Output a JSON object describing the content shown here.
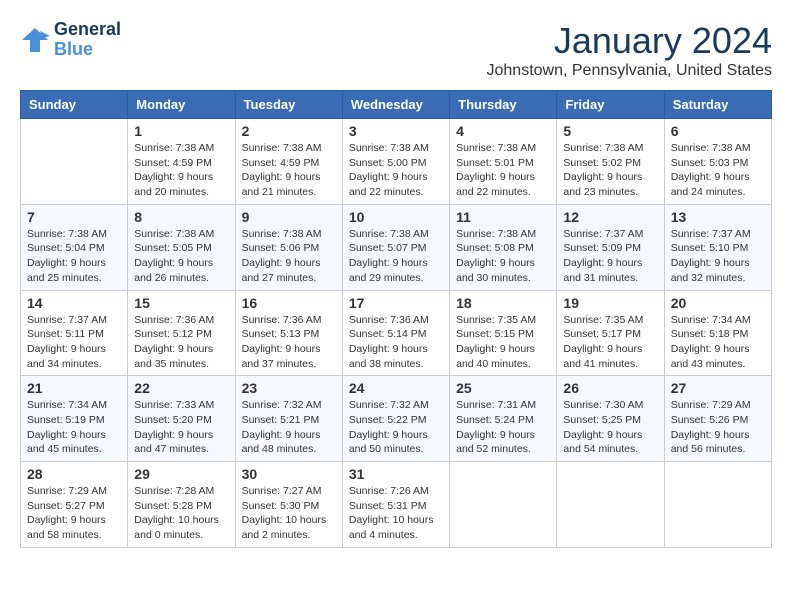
{
  "header": {
    "logo_text_general": "General",
    "logo_text_blue": "Blue",
    "month": "January 2024",
    "location": "Johnstown, Pennsylvania, United States"
  },
  "days_of_week": [
    "Sunday",
    "Monday",
    "Tuesday",
    "Wednesday",
    "Thursday",
    "Friday",
    "Saturday"
  ],
  "weeks": [
    [
      {
        "day": "",
        "sunrise": "",
        "sunset": "",
        "daylight": ""
      },
      {
        "day": "1",
        "sunrise": "Sunrise: 7:38 AM",
        "sunset": "Sunset: 4:59 PM",
        "daylight": "Daylight: 9 hours and 20 minutes."
      },
      {
        "day": "2",
        "sunrise": "Sunrise: 7:38 AM",
        "sunset": "Sunset: 4:59 PM",
        "daylight": "Daylight: 9 hours and 21 minutes."
      },
      {
        "day": "3",
        "sunrise": "Sunrise: 7:38 AM",
        "sunset": "Sunset: 5:00 PM",
        "daylight": "Daylight: 9 hours and 22 minutes."
      },
      {
        "day": "4",
        "sunrise": "Sunrise: 7:38 AM",
        "sunset": "Sunset: 5:01 PM",
        "daylight": "Daylight: 9 hours and 22 minutes."
      },
      {
        "day": "5",
        "sunrise": "Sunrise: 7:38 AM",
        "sunset": "Sunset: 5:02 PM",
        "daylight": "Daylight: 9 hours and 23 minutes."
      },
      {
        "day": "6",
        "sunrise": "Sunrise: 7:38 AM",
        "sunset": "Sunset: 5:03 PM",
        "daylight": "Daylight: 9 hours and 24 minutes."
      }
    ],
    [
      {
        "day": "7",
        "sunrise": "Sunrise: 7:38 AM",
        "sunset": "Sunset: 5:04 PM",
        "daylight": "Daylight: 9 hours and 25 minutes."
      },
      {
        "day": "8",
        "sunrise": "Sunrise: 7:38 AM",
        "sunset": "Sunset: 5:05 PM",
        "daylight": "Daylight: 9 hours and 26 minutes."
      },
      {
        "day": "9",
        "sunrise": "Sunrise: 7:38 AM",
        "sunset": "Sunset: 5:06 PM",
        "daylight": "Daylight: 9 hours and 27 minutes."
      },
      {
        "day": "10",
        "sunrise": "Sunrise: 7:38 AM",
        "sunset": "Sunset: 5:07 PM",
        "daylight": "Daylight: 9 hours and 29 minutes."
      },
      {
        "day": "11",
        "sunrise": "Sunrise: 7:38 AM",
        "sunset": "Sunset: 5:08 PM",
        "daylight": "Daylight: 9 hours and 30 minutes."
      },
      {
        "day": "12",
        "sunrise": "Sunrise: 7:37 AM",
        "sunset": "Sunset: 5:09 PM",
        "daylight": "Daylight: 9 hours and 31 minutes."
      },
      {
        "day": "13",
        "sunrise": "Sunrise: 7:37 AM",
        "sunset": "Sunset: 5:10 PM",
        "daylight": "Daylight: 9 hours and 32 minutes."
      }
    ],
    [
      {
        "day": "14",
        "sunrise": "Sunrise: 7:37 AM",
        "sunset": "Sunset: 5:11 PM",
        "daylight": "Daylight: 9 hours and 34 minutes."
      },
      {
        "day": "15",
        "sunrise": "Sunrise: 7:36 AM",
        "sunset": "Sunset: 5:12 PM",
        "daylight": "Daylight: 9 hours and 35 minutes."
      },
      {
        "day": "16",
        "sunrise": "Sunrise: 7:36 AM",
        "sunset": "Sunset: 5:13 PM",
        "daylight": "Daylight: 9 hours and 37 minutes."
      },
      {
        "day": "17",
        "sunrise": "Sunrise: 7:36 AM",
        "sunset": "Sunset: 5:14 PM",
        "daylight": "Daylight: 9 hours and 38 minutes."
      },
      {
        "day": "18",
        "sunrise": "Sunrise: 7:35 AM",
        "sunset": "Sunset: 5:15 PM",
        "daylight": "Daylight: 9 hours and 40 minutes."
      },
      {
        "day": "19",
        "sunrise": "Sunrise: 7:35 AM",
        "sunset": "Sunset: 5:17 PM",
        "daylight": "Daylight: 9 hours and 41 minutes."
      },
      {
        "day": "20",
        "sunrise": "Sunrise: 7:34 AM",
        "sunset": "Sunset: 5:18 PM",
        "daylight": "Daylight: 9 hours and 43 minutes."
      }
    ],
    [
      {
        "day": "21",
        "sunrise": "Sunrise: 7:34 AM",
        "sunset": "Sunset: 5:19 PM",
        "daylight": "Daylight: 9 hours and 45 minutes."
      },
      {
        "day": "22",
        "sunrise": "Sunrise: 7:33 AM",
        "sunset": "Sunset: 5:20 PM",
        "daylight": "Daylight: 9 hours and 47 minutes."
      },
      {
        "day": "23",
        "sunrise": "Sunrise: 7:32 AM",
        "sunset": "Sunset: 5:21 PM",
        "daylight": "Daylight: 9 hours and 48 minutes."
      },
      {
        "day": "24",
        "sunrise": "Sunrise: 7:32 AM",
        "sunset": "Sunset: 5:22 PM",
        "daylight": "Daylight: 9 hours and 50 minutes."
      },
      {
        "day": "25",
        "sunrise": "Sunrise: 7:31 AM",
        "sunset": "Sunset: 5:24 PM",
        "daylight": "Daylight: 9 hours and 52 minutes."
      },
      {
        "day": "26",
        "sunrise": "Sunrise: 7:30 AM",
        "sunset": "Sunset: 5:25 PM",
        "daylight": "Daylight: 9 hours and 54 minutes."
      },
      {
        "day": "27",
        "sunrise": "Sunrise: 7:29 AM",
        "sunset": "Sunset: 5:26 PM",
        "daylight": "Daylight: 9 hours and 56 minutes."
      }
    ],
    [
      {
        "day": "28",
        "sunrise": "Sunrise: 7:29 AM",
        "sunset": "Sunset: 5:27 PM",
        "daylight": "Daylight: 9 hours and 58 minutes."
      },
      {
        "day": "29",
        "sunrise": "Sunrise: 7:28 AM",
        "sunset": "Sunset: 5:28 PM",
        "daylight": "Daylight: 10 hours and 0 minutes."
      },
      {
        "day": "30",
        "sunrise": "Sunrise: 7:27 AM",
        "sunset": "Sunset: 5:30 PM",
        "daylight": "Daylight: 10 hours and 2 minutes."
      },
      {
        "day": "31",
        "sunrise": "Sunrise: 7:26 AM",
        "sunset": "Sunset: 5:31 PM",
        "daylight": "Daylight: 10 hours and 4 minutes."
      },
      {
        "day": "",
        "sunrise": "",
        "sunset": "",
        "daylight": ""
      },
      {
        "day": "",
        "sunrise": "",
        "sunset": "",
        "daylight": ""
      },
      {
        "day": "",
        "sunrise": "",
        "sunset": "",
        "daylight": ""
      }
    ]
  ]
}
